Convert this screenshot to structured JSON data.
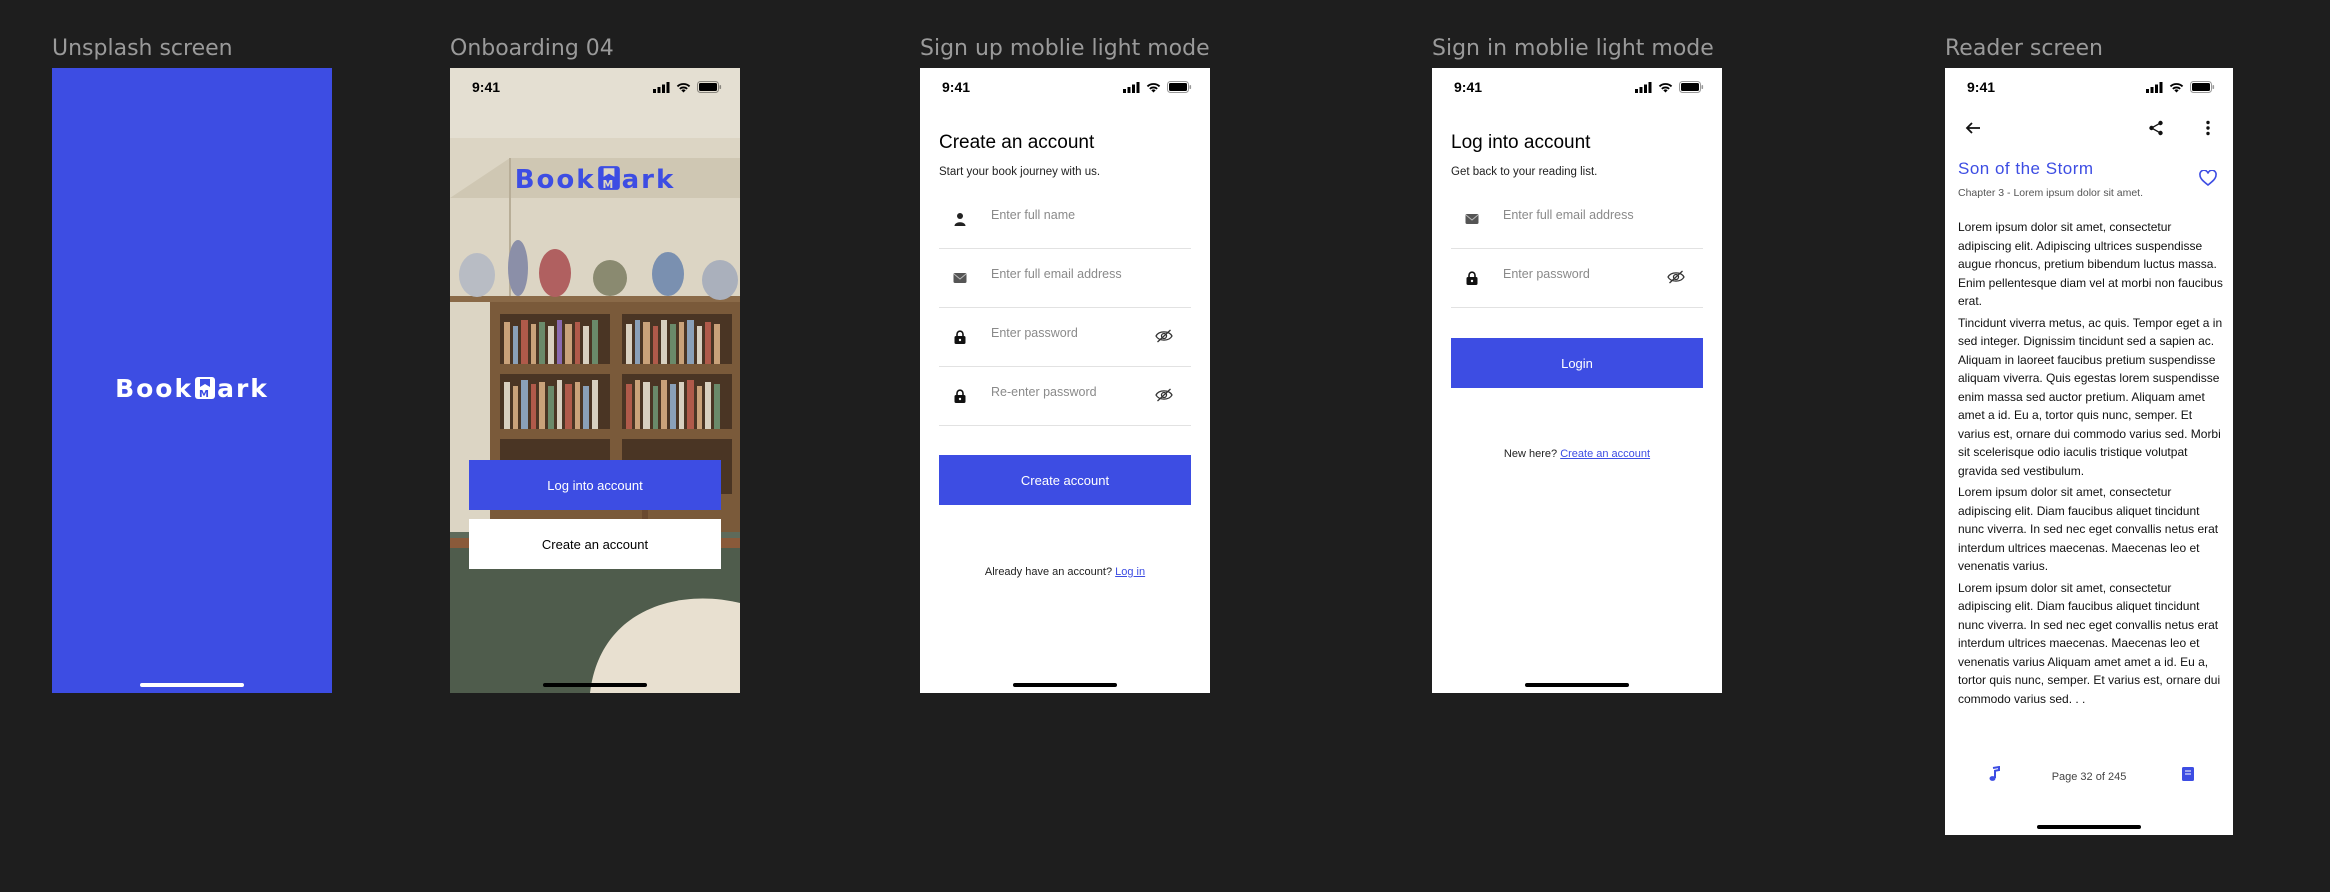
{
  "canvas": {
    "background": "#1e1e1e"
  },
  "colors": {
    "accent": "#3d4de3",
    "screen_bg": "#ffffff"
  },
  "frames": {
    "splash_label": "Unsplash screen",
    "onboarding_label": "Onboarding 04",
    "signup_label": "Sign up moblie light mode",
    "signin_label": "Sign in moblie light mode",
    "reader_label": "Reader screen"
  },
  "status_bar": {
    "time": "9:41"
  },
  "brand": {
    "left": "Book",
    "right": "ark",
    "logo_icon": "bookmark-m-icon"
  },
  "onboarding": {
    "login_button": "Log into account",
    "create_button": "Create an account"
  },
  "signup": {
    "title": "Create an account",
    "subtitle": "Start your book journey with us.",
    "name_placeholder": "Enter full name",
    "email_placeholder": "Enter full email address",
    "password_placeholder": "Enter password",
    "reenter_placeholder": "Re-enter password",
    "submit_button": "Create account",
    "footer_text": "Already have an account?",
    "footer_link": "Log in"
  },
  "signin": {
    "title": "Log into account",
    "subtitle": "Get back to your reading list.",
    "email_placeholder": "Enter full email address",
    "password_placeholder": "Enter password",
    "submit_button": "Login",
    "footer_text": "New here?",
    "footer_link": "Create an account"
  },
  "reader": {
    "book_title": "Son of the Storm",
    "chapter": "Chapter 3 - Lorem ipsum dolor sit amet.",
    "paragraphs": [
      "Lorem ipsum dolor sit amet, consectetur adipiscing elit. Adipiscing ultrices suspendisse augue rhoncus, pretium bibendum luctus massa. Enim pellentesque diam vel at morbi non faucibus erat.",
      "Tincidunt viverra metus, ac quis. Tempor eget a in sed integer. Dignissim tincidunt sed a sapien ac. Aliquam in laoreet faucibus pretium suspendisse aliquam viverra. Quis egestas lorem suspendisse enim massa sed auctor pretium. Aliquam amet amet a id. Eu a, tortor quis nunc, semper. Et varius est, ornare dui commodo varius sed. Morbi sit scelerisque odio iaculis tristique volutpat gravida sed vestibulum.",
      "Lorem ipsum dolor sit amet, consectetur adipiscing elit. Diam faucibus aliquet tincidunt nunc viverra. In sed nec eget convallis netus erat interdum ultrices maecenas. Maecenas leo et venenatis varius.",
      "Lorem ipsum dolor sit amet, consectetur adipiscing elit. Diam faucibus aliquet tincidunt nunc viverra. In sed nec eget convallis netus erat interdum ultrices maecenas. Maecenas leo et venenatis varius Aliquam amet amet a id. Eu a, tortor quis nunc, semper. Et varius est, ornare dui commodo varius sed. . ."
    ],
    "page_indicator": "Page 32 of 245"
  }
}
